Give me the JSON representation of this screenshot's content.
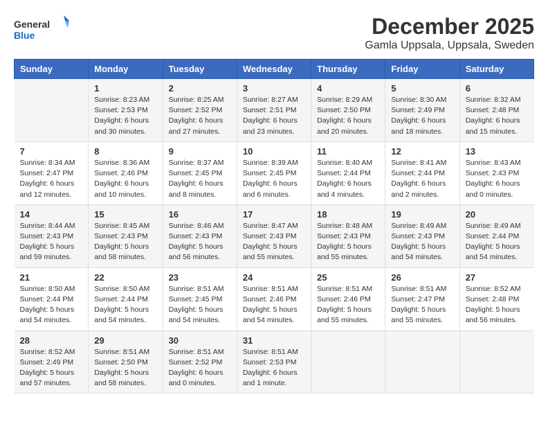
{
  "logo": {
    "general": "General",
    "blue": "Blue"
  },
  "title": "December 2025",
  "subtitle": "Gamla Uppsala, Uppsala, Sweden",
  "days_of_week": [
    "Sunday",
    "Monday",
    "Tuesday",
    "Wednesday",
    "Thursday",
    "Friday",
    "Saturday"
  ],
  "weeks": [
    [
      {
        "day": "",
        "info": ""
      },
      {
        "day": "1",
        "info": "Sunrise: 8:23 AM\nSunset: 2:53 PM\nDaylight: 6 hours\nand 30 minutes."
      },
      {
        "day": "2",
        "info": "Sunrise: 8:25 AM\nSunset: 2:52 PM\nDaylight: 6 hours\nand 27 minutes."
      },
      {
        "day": "3",
        "info": "Sunrise: 8:27 AM\nSunset: 2:51 PM\nDaylight: 6 hours\nand 23 minutes."
      },
      {
        "day": "4",
        "info": "Sunrise: 8:29 AM\nSunset: 2:50 PM\nDaylight: 6 hours\nand 20 minutes."
      },
      {
        "day": "5",
        "info": "Sunrise: 8:30 AM\nSunset: 2:49 PM\nDaylight: 6 hours\nand 18 minutes."
      },
      {
        "day": "6",
        "info": "Sunrise: 8:32 AM\nSunset: 2:48 PM\nDaylight: 6 hours\nand 15 minutes."
      }
    ],
    [
      {
        "day": "7",
        "info": "Sunrise: 8:34 AM\nSunset: 2:47 PM\nDaylight: 6 hours\nand 12 minutes."
      },
      {
        "day": "8",
        "info": "Sunrise: 8:36 AM\nSunset: 2:46 PM\nDaylight: 6 hours\nand 10 minutes."
      },
      {
        "day": "9",
        "info": "Sunrise: 8:37 AM\nSunset: 2:45 PM\nDaylight: 6 hours\nand 8 minutes."
      },
      {
        "day": "10",
        "info": "Sunrise: 8:39 AM\nSunset: 2:45 PM\nDaylight: 6 hours\nand 6 minutes."
      },
      {
        "day": "11",
        "info": "Sunrise: 8:40 AM\nSunset: 2:44 PM\nDaylight: 6 hours\nand 4 minutes."
      },
      {
        "day": "12",
        "info": "Sunrise: 8:41 AM\nSunset: 2:44 PM\nDaylight: 6 hours\nand 2 minutes."
      },
      {
        "day": "13",
        "info": "Sunrise: 8:43 AM\nSunset: 2:43 PM\nDaylight: 6 hours\nand 0 minutes."
      }
    ],
    [
      {
        "day": "14",
        "info": "Sunrise: 8:44 AM\nSunset: 2:43 PM\nDaylight: 5 hours\nand 59 minutes."
      },
      {
        "day": "15",
        "info": "Sunrise: 8:45 AM\nSunset: 2:43 PM\nDaylight: 5 hours\nand 58 minutes."
      },
      {
        "day": "16",
        "info": "Sunrise: 8:46 AM\nSunset: 2:43 PM\nDaylight: 5 hours\nand 56 minutes."
      },
      {
        "day": "17",
        "info": "Sunrise: 8:47 AM\nSunset: 2:43 PM\nDaylight: 5 hours\nand 55 minutes."
      },
      {
        "day": "18",
        "info": "Sunrise: 8:48 AM\nSunset: 2:43 PM\nDaylight: 5 hours\nand 55 minutes."
      },
      {
        "day": "19",
        "info": "Sunrise: 8:49 AM\nSunset: 2:43 PM\nDaylight: 5 hours\nand 54 minutes."
      },
      {
        "day": "20",
        "info": "Sunrise: 8:49 AM\nSunset: 2:44 PM\nDaylight: 5 hours\nand 54 minutes."
      }
    ],
    [
      {
        "day": "21",
        "info": "Sunrise: 8:50 AM\nSunset: 2:44 PM\nDaylight: 5 hours\nand 54 minutes."
      },
      {
        "day": "22",
        "info": "Sunrise: 8:50 AM\nSunset: 2:44 PM\nDaylight: 5 hours\nand 54 minutes."
      },
      {
        "day": "23",
        "info": "Sunrise: 8:51 AM\nSunset: 2:45 PM\nDaylight: 5 hours\nand 54 minutes."
      },
      {
        "day": "24",
        "info": "Sunrise: 8:51 AM\nSunset: 2:46 PM\nDaylight: 5 hours\nand 54 minutes."
      },
      {
        "day": "25",
        "info": "Sunrise: 8:51 AM\nSunset: 2:46 PM\nDaylight: 5 hours\nand 55 minutes."
      },
      {
        "day": "26",
        "info": "Sunrise: 8:51 AM\nSunset: 2:47 PM\nDaylight: 5 hours\nand 55 minutes."
      },
      {
        "day": "27",
        "info": "Sunrise: 8:52 AM\nSunset: 2:48 PM\nDaylight: 5 hours\nand 56 minutes."
      }
    ],
    [
      {
        "day": "28",
        "info": "Sunrise: 8:52 AM\nSunset: 2:49 PM\nDaylight: 5 hours\nand 57 minutes."
      },
      {
        "day": "29",
        "info": "Sunrise: 8:51 AM\nSunset: 2:50 PM\nDaylight: 5 hours\nand 58 minutes."
      },
      {
        "day": "30",
        "info": "Sunrise: 8:51 AM\nSunset: 2:52 PM\nDaylight: 6 hours\nand 0 minutes."
      },
      {
        "day": "31",
        "info": "Sunrise: 8:51 AM\nSunset: 2:53 PM\nDaylight: 6 hours\nand 1 minute."
      },
      {
        "day": "",
        "info": ""
      },
      {
        "day": "",
        "info": ""
      },
      {
        "day": "",
        "info": ""
      }
    ]
  ]
}
